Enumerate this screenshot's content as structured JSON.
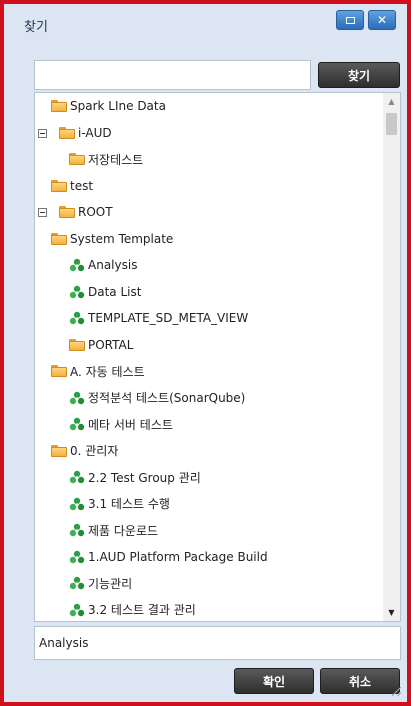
{
  "dialog": {
    "title": "찾기",
    "max_icon": "maximize-icon",
    "close_icon": "close-icon"
  },
  "search": {
    "value": "",
    "placeholder": "",
    "button_label": "찾기"
  },
  "tree": {
    "items": [
      {
        "label": "Spark LIne Data",
        "type": "folder",
        "level": 1,
        "expanded": false
      },
      {
        "label": "i-AUD",
        "type": "folder",
        "level": 0,
        "expanded": true
      },
      {
        "label": "저장테스트",
        "type": "folder",
        "level": 2,
        "expanded": false
      },
      {
        "label": "test",
        "type": "folder",
        "level": 1,
        "expanded": false
      },
      {
        "label": "ROOT",
        "type": "folder",
        "level": 0,
        "expanded": true
      },
      {
        "label": "System Template",
        "type": "folder",
        "level": 1,
        "expanded": true
      },
      {
        "label": "Analysis",
        "type": "report",
        "level": 2
      },
      {
        "label": "Data List",
        "type": "report",
        "level": 2
      },
      {
        "label": "TEMPLATE_SD_META_VIEW",
        "type": "report",
        "level": 2
      },
      {
        "label": "PORTAL",
        "type": "folder",
        "level": 2,
        "expanded": false
      },
      {
        "label": "A. 자동 테스트",
        "type": "folder",
        "level": 1,
        "expanded": true
      },
      {
        "label": "정적분석 테스트(SonarQube)",
        "type": "report",
        "level": 2
      },
      {
        "label": "메타 서버 테스트",
        "type": "report",
        "level": 2
      },
      {
        "label": "0. 관리자",
        "type": "folder",
        "level": 1,
        "expanded": true
      },
      {
        "label": "2.2 Test Group 관리",
        "type": "report",
        "level": 2
      },
      {
        "label": "3.1 테스트 수행",
        "type": "report",
        "level": 2
      },
      {
        "label": "제품 다운로드",
        "type": "report",
        "level": 2
      },
      {
        "label": "1.AUD Platform Package Build",
        "type": "report",
        "level": 2
      },
      {
        "label": "기능관리",
        "type": "report",
        "level": 2
      },
      {
        "label": "3.2 테스트 결과 관리",
        "type": "report",
        "level": 2
      }
    ]
  },
  "selected": {
    "value": "Analysis"
  },
  "footer": {
    "ok_label": "확인",
    "cancel_label": "취소"
  },
  "colors": {
    "frame_border": "#d0101c",
    "dialog_bg": "#dce6f2",
    "title_button": "#2b6cb8",
    "dark_button": "#333333",
    "folder": "#f4b13f",
    "report": "#2e9d43"
  }
}
